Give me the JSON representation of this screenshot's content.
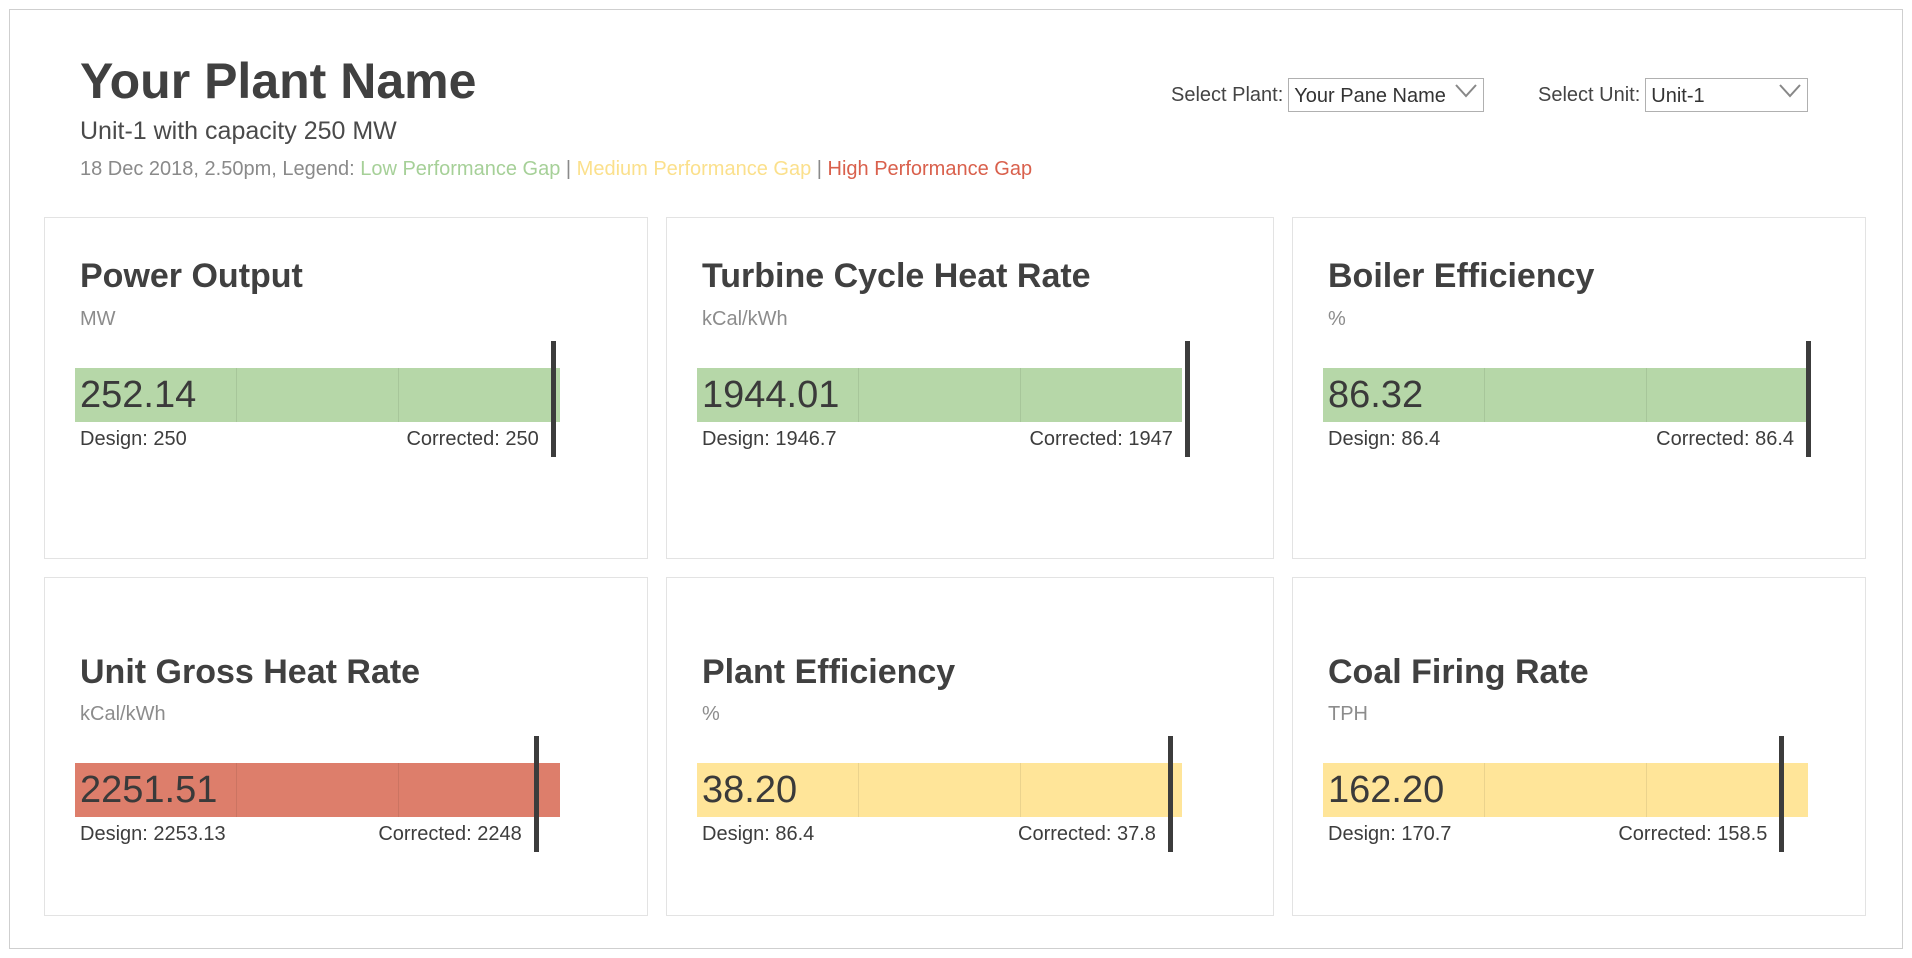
{
  "header": {
    "title": "Your Plant Name",
    "subtitle": "Unit-1 with capacity 250 MW",
    "date_legend_prefix": "18 Dec 2018, 2.50pm, Legend:",
    "legend_low": "Low Performance Gap",
    "legend_medium": "Medium Performance Gap",
    "legend_high": "High Performance Gap",
    "separator": "|"
  },
  "controls": {
    "plant_label": "Select Plant:",
    "plant_value": "Your Pane Name",
    "unit_label": "Select Unit:",
    "unit_value": "Unit-1"
  },
  "colors": {
    "low": "#b6d7a8",
    "medium": "#ffe599",
    "high": "#dd7e6b"
  },
  "cards": [
    {
      "title": "Power Output",
      "unit": "MW",
      "value": "252.14",
      "design": "Design: 250",
      "corrected": "Corrected: 250",
      "gap": "low",
      "fill_fraction": 1.0,
      "marker_fraction": 0.985
    },
    {
      "title": "Turbine Cycle Heat Rate",
      "unit": "kCal/kWh",
      "value": "1944.01",
      "design": "Design: 1946.7",
      "corrected": "Corrected: 1947",
      "gap": "low",
      "fill_fraction": 1.0,
      "marker_fraction": 1.01
    },
    {
      "title": "Boiler Efficiency",
      "unit": "%",
      "value": "86.32",
      "design": "Design: 86.4",
      "corrected": "Corrected: 86.4",
      "gap": "low",
      "fill_fraction": 1.0,
      "marker_fraction": 1.0
    },
    {
      "title": "Unit Gross Heat Rate",
      "unit": "kCal/kWh",
      "value": "2251.51",
      "design": "Design: 2253.13",
      "corrected": "Corrected: 2248",
      "gap": "high",
      "fill_fraction": 1.0,
      "marker_fraction": 0.95
    },
    {
      "title": "Plant Efficiency",
      "unit": "%",
      "value": "38.20",
      "design": "Design: 86.4",
      "corrected": "Corrected: 37.8",
      "gap": "medium",
      "fill_fraction": 1.0,
      "marker_fraction": 0.975
    },
    {
      "title": "Coal Firing Rate",
      "unit": "TPH",
      "value": "162.20",
      "design": "Design: 170.7",
      "corrected": "Corrected: 158.5",
      "gap": "medium",
      "fill_fraction": 1.0,
      "marker_fraction": 0.945
    }
  ]
}
